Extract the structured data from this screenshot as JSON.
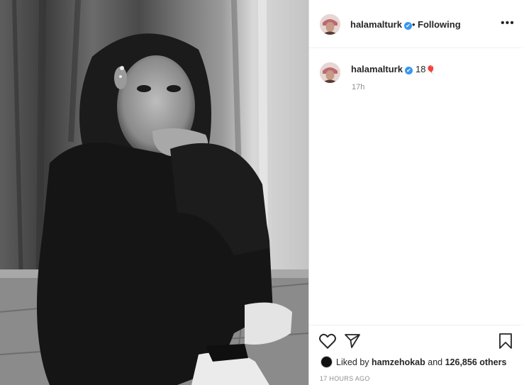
{
  "post": {
    "image_alt_subject": "black-and-white photo"
  },
  "header": {
    "username": "halamalturk",
    "verified_mark": "✔",
    "separator": "•",
    "follow_status": "Following",
    "more_label": "•••"
  },
  "caption": {
    "username": "halamalturk",
    "verified_mark": "✔",
    "text": "18",
    "emoji": "🎈",
    "time": "17h"
  },
  "actions": {
    "like_icon": "heart-icon",
    "share_icon": "paper-plane-icon",
    "save_icon": "bookmark-icon"
  },
  "likes": {
    "prefix": "Liked by",
    "liker": "hamzehokab",
    "conjunction": "and",
    "others": "126,856 others"
  },
  "date": "17 HOURS AGO",
  "colors": {
    "verified": "#3897f0",
    "text": "#262626",
    "muted": "#8e8e8e"
  }
}
